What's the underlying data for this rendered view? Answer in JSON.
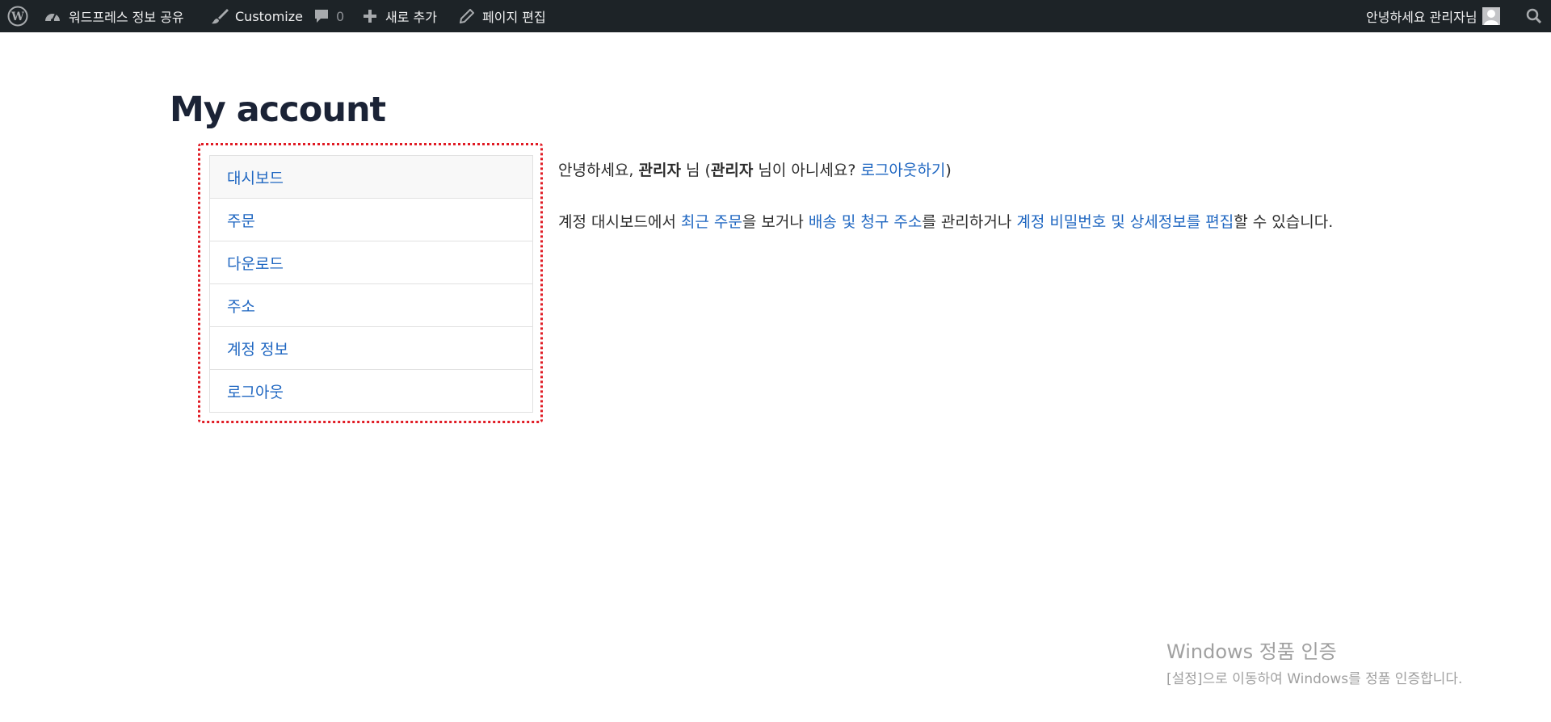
{
  "adminbar": {
    "site_name": "워드프레스 정보 공유",
    "customize": "Customize",
    "comments_count": "0",
    "new_content": "새로 추가",
    "edit_page": "페이지 편집",
    "greeting": "안녕하세요 관리자님",
    "icons": [
      "wordpress-logo-icon",
      "dashboard-icon",
      "brush-icon",
      "comment-icon",
      "plus-icon",
      "pencil-icon",
      "avatar",
      "search-icon"
    ],
    "background_color": "#1d2327"
  },
  "page": {
    "title": "My account"
  },
  "account_nav": {
    "items": [
      {
        "label": "대시보드",
        "active": true
      },
      {
        "label": "주문"
      },
      {
        "label": "다운로드"
      },
      {
        "label": "주소"
      },
      {
        "label": "계정 정보"
      },
      {
        "label": "로그아웃"
      }
    ],
    "highlight_color": "#e01b24"
  },
  "dashboard": {
    "hello_prefix": "안녕하세요, ",
    "user": "관리자",
    "hello_mid": " 님 (",
    "user2": "관리자",
    "hello_not": " 님이 아니세요? ",
    "logout_link": "로그아웃하기",
    "hello_suffix": ")",
    "desc_1": "계정 대시보드에서 ",
    "link_orders": "최근 주문",
    "desc_2": "을 보거나 ",
    "link_addresses": "배송 및 청구 주소",
    "desc_3": "를 관리하거나 ",
    "link_account": "계정 비밀번호 및 상세정보를 편집",
    "desc_4": "할 수 있습니다.",
    "link_color": "#1e66c1"
  },
  "windows_activation": {
    "title": "Windows 정품 인증",
    "subtitle": "[설정]으로 이동하여 Windows를 정품 인증합니다."
  }
}
